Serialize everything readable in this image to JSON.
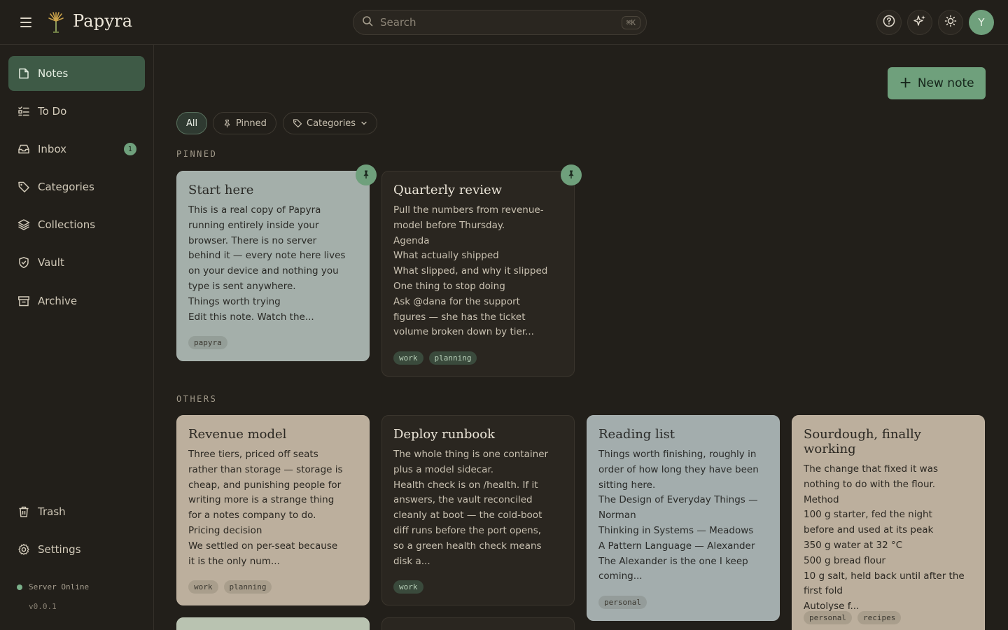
{
  "app": {
    "brand": "Papyra"
  },
  "search": {
    "placeholder": "Search",
    "shortcut": "⌘K"
  },
  "header": {
    "user_initial": "Y"
  },
  "sidebar": {
    "items": [
      {
        "label": "Notes",
        "icon": "note-icon",
        "active": true
      },
      {
        "label": "To Do",
        "icon": "checklist-icon"
      },
      {
        "label": "Inbox",
        "icon": "inbox-icon",
        "badge": "1"
      },
      {
        "label": "Categories",
        "icon": "tag-icon"
      },
      {
        "label": "Collections",
        "icon": "layers-icon"
      },
      {
        "label": "Vault",
        "icon": "shield-icon"
      },
      {
        "label": "Archive",
        "icon": "archive-icon"
      }
    ],
    "bottom": [
      {
        "label": "Trash",
        "icon": "trash-icon"
      },
      {
        "label": "Settings",
        "icon": "gear-icon"
      }
    ],
    "server_status": "Server Online",
    "version": "v0.0.1"
  },
  "toolbar": {
    "new_note": "New note"
  },
  "filters": {
    "all": "All",
    "pinned": "Pinned",
    "categories": "Categories"
  },
  "sections": {
    "pinned": "PINNED",
    "others": "OTHERS"
  },
  "colors": {
    "accent": "#6fa07c",
    "active_nav": "#3e5a46",
    "background": "#221f1a"
  },
  "pinned_notes": [
    {
      "title": "Start here",
      "lines": [
        "This is a real copy of Papyra",
        "running entirely inside your",
        "browser. There is no server",
        "behind it — every note here lives",
        "on your device and nothing you",
        "type is sent anywhere.",
        "Things worth trying",
        "Edit this note. Watch the..."
      ],
      "tags": [
        "papyra"
      ]
    },
    {
      "title": "Quarterly review",
      "lines": [
        "Pull the numbers from revenue-",
        "model before Thursday.",
        "Agenda",
        "What actually shipped",
        "What slipped, and why it slipped",
        "One thing to stop doing",
        "Ask @dana for the support",
        "figures — she has the ticket",
        "volume broken down by tier..."
      ],
      "tags": [
        "work",
        "planning"
      ]
    }
  ],
  "other_notes": [
    {
      "title": "Revenue model",
      "lines": [
        "Three tiers, priced off seats",
        "rather than storage — storage is",
        "cheap, and punishing people for",
        "writing more is a strange thing",
        "for a notes company to do.",
        "Pricing decision",
        "We settled on per-seat because",
        "it is the only num..."
      ],
      "tags": [
        "work",
        "planning"
      ]
    },
    {
      "title": "Deploy runbook",
      "lines": [
        "The whole thing is one container",
        "plus a model sidecar.",
        "Health check is on /health. If it",
        "answers, the vault reconciled",
        "cleanly at boot — the cold-boot",
        "diff runs before the port opens,",
        "so a green health check means",
        "disk a..."
      ],
      "tags": [
        "work"
      ]
    },
    {
      "title": "Reading list",
      "lines": [
        "Things worth finishing, roughly in",
        "order of how long they have been",
        "sitting here.",
        "The Design of Everyday Things —",
        "Norman",
        "Thinking in Systems — Meadows",
        "A Pattern Language — Alexander",
        "The Alexander is the one I keep",
        "coming..."
      ],
      "tags": [
        "personal"
      ]
    },
    {
      "title": "Sourdough, finally working",
      "lines": [
        "The change that fixed it was",
        "nothing to do with the flour.",
        "Method",
        "100 g starter, fed the night",
        "before and used at its peak",
        "350 g water at 32 °C",
        "500 g bread flour",
        "10 g salt, held back until after the",
        "first fold",
        "Autolyse f..."
      ],
      "tags": [
        "personal",
        "recipes"
      ]
    }
  ]
}
